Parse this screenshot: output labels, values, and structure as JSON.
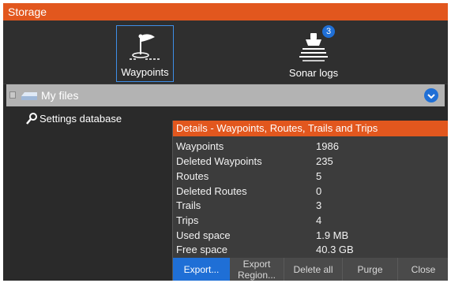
{
  "window": {
    "title": "Storage"
  },
  "tiles": {
    "waypoints": {
      "label": "Waypoints",
      "icon": "waypoint-flag-icon",
      "selected": true
    },
    "sonar_logs": {
      "label": "Sonar logs",
      "icon": "sonar-log-icon",
      "badge": "3"
    }
  },
  "tree": {
    "my_files": "My files",
    "settings_database": "Settings database"
  },
  "details": {
    "title": "Details - Waypoints, Routes, Trails and Trips",
    "rows": [
      {
        "key": "Waypoints",
        "value": "1986"
      },
      {
        "key": "Deleted Waypoints",
        "value": "235"
      },
      {
        "key": "Routes",
        "value": "5"
      },
      {
        "key": "Deleted Routes",
        "value": "0"
      },
      {
        "key": "Trails",
        "value": "3"
      },
      {
        "key": "Trips",
        "value": "4"
      },
      {
        "key": "Used space",
        "value": "1.9 MB"
      },
      {
        "key": "Free space",
        "value": "40.3 GB"
      }
    ],
    "buttons": {
      "export": "Export...",
      "export_region_1": "Export",
      "export_region_2": "Region...",
      "delete_all": "Delete all",
      "purge": "Purge",
      "close": "Close"
    }
  },
  "colors": {
    "accent": "#e2571e",
    "selection": "#1f6fd6",
    "panel": "#2a2a2a"
  }
}
